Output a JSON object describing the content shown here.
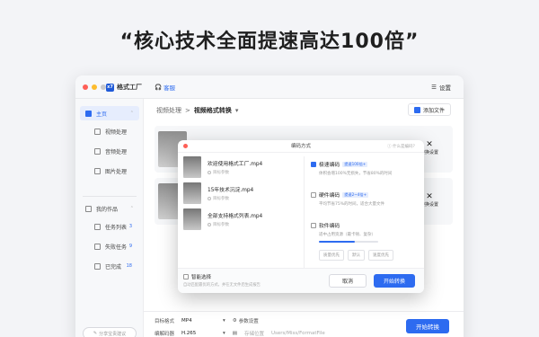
{
  "headline": "“核心技术全面提速高达100倍”",
  "window": {
    "brand_logo": "x7",
    "brand": "格式工厂",
    "service": "客服",
    "settings": "设置"
  },
  "sidebar": {
    "items": [
      {
        "label": "主页",
        "count": ""
      },
      {
        "label": "视频处理",
        "count": ""
      },
      {
        "label": "音频处理",
        "count": ""
      },
      {
        "label": "图片处理",
        "count": ""
      },
      {
        "label": "我的作品",
        "count": ""
      },
      {
        "label": "任务列表",
        "count": "3"
      },
      {
        "label": "失败任务",
        "count": "9"
      },
      {
        "label": "已完成",
        "count": "18"
      }
    ],
    "share": "分享宝贵建议"
  },
  "breadcrumb": {
    "parent": "视频处理",
    "sep": ">",
    "current": "视频格式转换"
  },
  "add_file": "添加文件",
  "cards": [
    {
      "action": "转换设置"
    },
    {
      "action": "转换设置"
    }
  ],
  "bottom": {
    "format_label": "目标格式",
    "format_value": "MP4",
    "params_label": "参数设置",
    "codec_label": "编解码器",
    "codec_value": "H.265",
    "path_label": "存储位置",
    "path_value": "Users/Miss/FormatFile",
    "start": "开始转换"
  },
  "dialog": {
    "title": "编码方式",
    "help": "什么是编码？",
    "files": [
      {
        "name": "欢迎使用格式工厂.mp4",
        "sub": "目标参数"
      },
      {
        "name": "15年技术沉淀.mp4",
        "sub": "目标参数"
      },
      {
        "name": "全部支持格式列表.mp4",
        "sub": "目标参数"
      }
    ],
    "options": [
      {
        "title": "极速编码",
        "tag": "提速100倍+",
        "desc": "体积会增100%无损失，节省80%的时间",
        "checked": true
      },
      {
        "title": "硬件编码",
        "tag": "提速2~4倍+",
        "desc": "平均节省75%的时间，适合大量文件",
        "checked": false
      },
      {
        "title": "软件编码",
        "tag": "",
        "desc": "适中占用资源（最卡顿、复杂）",
        "checked": false
      }
    ],
    "slider_level": 0.6,
    "presets": [
      "质量优先",
      "默认",
      "速度优先"
    ],
    "smart_label": "智能选择",
    "smart_desc": "自动匹配最优的方式，并在无文件后生成报告",
    "cancel": "取消",
    "confirm": "开始转换"
  },
  "colors": {
    "accent": "#2d6bf0"
  }
}
